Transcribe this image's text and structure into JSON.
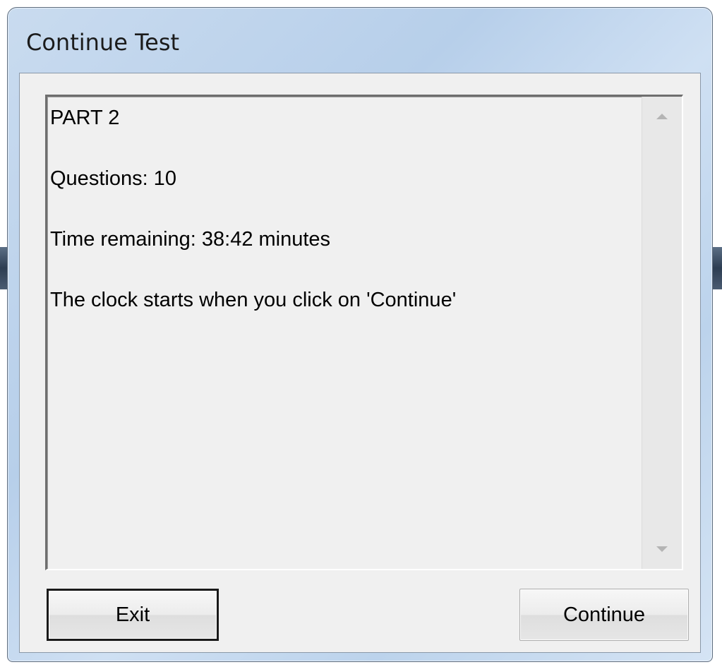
{
  "window": {
    "title": "Continue Test"
  },
  "textbox": {
    "lines": [
      "PART 2",
      "Questions: 10",
      "Time remaining: 38:42 minutes",
      "The clock starts when you click on 'Continue'"
    ]
  },
  "buttons": {
    "exit_label": "Exit",
    "continue_label": "Continue"
  },
  "icons": {
    "scroll_up": "scroll-up-arrow-icon",
    "scroll_down": "scroll-down-arrow-icon"
  },
  "colors": {
    "titlebar": "#bcd3ec",
    "client_bg": "#f0f0f0",
    "text": "#000000"
  }
}
